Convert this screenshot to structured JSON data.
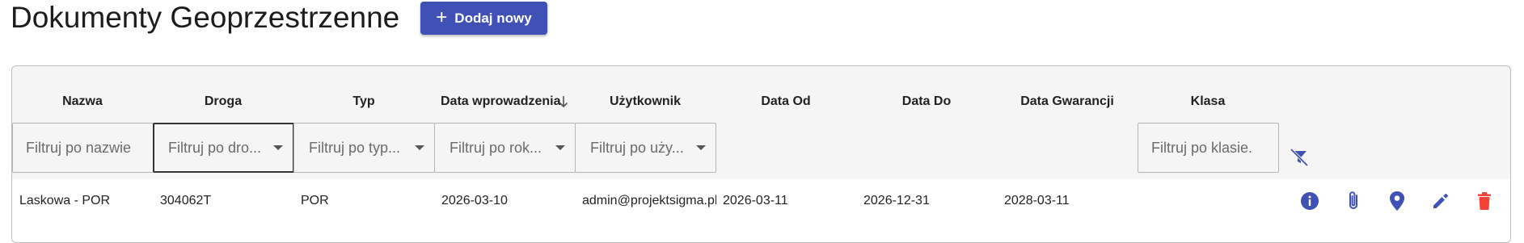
{
  "page": {
    "title": "Dokumenty Geoprzestrzenne"
  },
  "toolbar": {
    "add_label": "Dodaj nowy"
  },
  "table": {
    "columns": {
      "nazwa": "Nazwa",
      "droga": "Droga",
      "typ": "Typ",
      "data_wprowadzenia": "Data wprowadzenia",
      "uzytkownik": "Użytkownik",
      "data_od": "Data Od",
      "data_do": "Data Do",
      "data_gwarancji": "Data Gwarancji",
      "klasa": "Klasa"
    },
    "sort": {
      "column": "Data wprowadzenia",
      "direction": "desc"
    },
    "filters": {
      "nazwa": "Filtruj po nazwie",
      "droga": "Filtruj po dro...",
      "typ": "Filtruj po typ...",
      "data_wprowadzenia": "Filtruj po rok...",
      "uzytkownik": "Filtruj po uży...",
      "klasa": "Filtruj po klasie."
    },
    "rows": [
      {
        "nazwa": "Laskowa - POR",
        "droga": "304062T",
        "typ": "POR",
        "data_wprowadzenia": "2026-03-10",
        "uzytkownik": "admin@projektsigma.pl",
        "data_od": "2026-03-11",
        "data_do": "2026-12-31",
        "data_gwarancji": "2028-03-11"
      }
    ]
  },
  "icons": {
    "clear_filters": "filter-off-icon",
    "info": "info-icon",
    "attachment": "paperclip-icon",
    "location": "map-pin-icon",
    "edit": "pencil-icon",
    "delete": "trash-icon"
  },
  "colors": {
    "primary": "#3f51b5",
    "danger": "#f44336"
  }
}
